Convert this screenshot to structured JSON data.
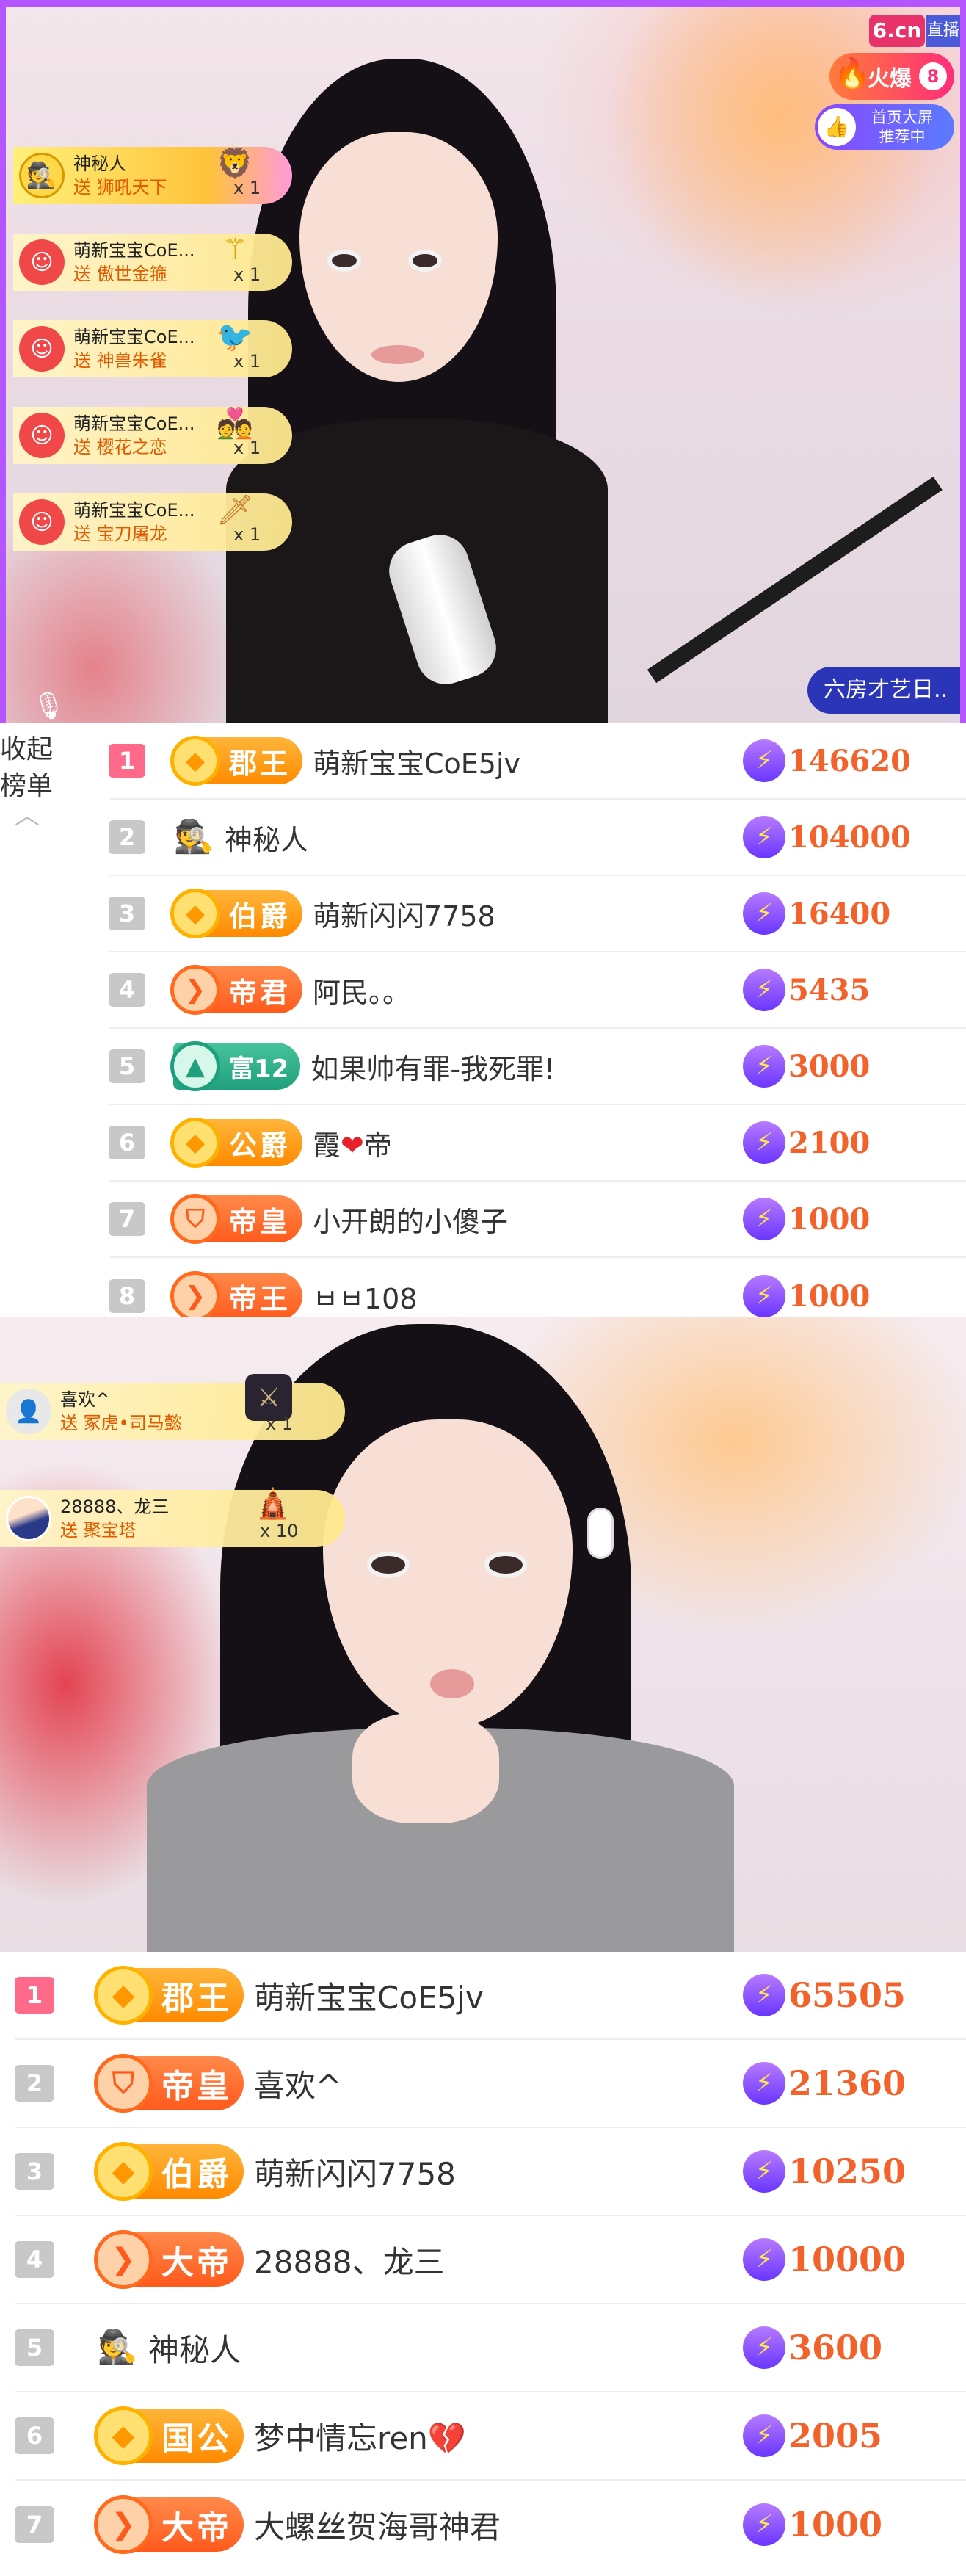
{
  "top_badges": {
    "logo": "6.cn",
    "live": "直播",
    "fire_label": "火爆",
    "fire_count": "8",
    "promo_line1": "首页大屏",
    "promo_line2": "推荐中"
  },
  "room_chip": "六房才艺日..",
  "collapse_label": "收起榜单",
  "gifts_top": [
    {
      "name": "神秘人",
      "action": "送 狮吼天下",
      "count": "x 1",
      "avatar": "mystery-icon",
      "gift_icon": "lion-statue-icon"
    },
    {
      "name": "萌新宝宝CoE...",
      "action": "送 傲世金箍",
      "count": "x 1",
      "avatar": "red-face-icon",
      "gift_icon": "golden-staff-icon"
    },
    {
      "name": "萌新宝宝CoE...",
      "action": "送 神兽朱雀",
      "count": "x 1",
      "avatar": "red-face-icon",
      "gift_icon": "phoenix-icon"
    },
    {
      "name": "萌新宝宝CoE...",
      "action": "送 樱花之恋",
      "count": "x 1",
      "avatar": "red-face-icon",
      "gift_icon": "couple-icon"
    },
    {
      "name": "萌新宝宝CoE...",
      "action": "送 宝刀屠龙",
      "count": "x 1",
      "avatar": "red-face-icon",
      "gift_icon": "sword-icon"
    }
  ],
  "gifts_bottom": [
    {
      "name": "喜欢^",
      "action": "送 冢虎•司马懿",
      "count": "x 1",
      "avatar": "default-user-icon",
      "gift_icon": "warrior-card-icon"
    },
    {
      "name": "28888、龙三",
      "action": "送 聚宝塔",
      "count": "x 10",
      "avatar": "user-photo",
      "gift_icon": "pagoda-icon"
    }
  ],
  "rank1": [
    {
      "rank": "1",
      "badge": "郡王",
      "badge_style": "gold",
      "name": "萌新宝宝CoE5jv",
      "score": "146620"
    },
    {
      "rank": "2",
      "badge": "",
      "badge_style": "mystery",
      "name": "神秘人",
      "score": "104000"
    },
    {
      "rank": "3",
      "badge": "伯爵",
      "badge_style": "gold",
      "name": "萌新闪闪7758",
      "score": "16400"
    },
    {
      "rank": "4",
      "badge": "帝君",
      "badge_style": "orange",
      "name": "阿民。。",
      "score": "5435"
    },
    {
      "rank": "5",
      "badge": "富12",
      "badge_style": "green",
      "name": "如果帅有罪-我死罪!",
      "score": "3000"
    },
    {
      "rank": "6",
      "badge": "公爵",
      "badge_style": "gold",
      "name": "霞",
      "name_suffix": "帝",
      "heart": true,
      "score": "2100"
    },
    {
      "rank": "7",
      "badge": "帝皇",
      "badge_style": "orange",
      "name": "小开朗的小傻子",
      "score": "1000"
    },
    {
      "rank": "8",
      "badge": "帝王",
      "badge_style": "orange",
      "name": "ㅂㅂ108",
      "score": "1000"
    }
  ],
  "rank2": [
    {
      "rank": "1",
      "badge": "郡王",
      "badge_style": "gold",
      "name": "萌新宝宝CoE5jv",
      "score": "65505"
    },
    {
      "rank": "2",
      "badge": "帝皇",
      "badge_style": "orange",
      "name": "喜欢^",
      "score": "21360"
    },
    {
      "rank": "3",
      "badge": "伯爵",
      "badge_style": "gold",
      "name": "萌新闪闪7758",
      "score": "10250"
    },
    {
      "rank": "4",
      "badge": "大帝",
      "badge_style": "orange",
      "name": "28888、龙三",
      "score": "10000"
    },
    {
      "rank": "5",
      "badge": "",
      "badge_style": "mystery",
      "name": "神秘人",
      "score": "3600"
    },
    {
      "rank": "6",
      "badge": "国公",
      "badge_style": "gold",
      "name": "梦中情忘ren",
      "heart": true,
      "score": "2005"
    },
    {
      "rank": "7",
      "badge": "大帝",
      "badge_style": "orange",
      "name": "大螺丝贺海哥神君",
      "score": "1000"
    }
  ],
  "colors": {
    "frame": "#b455ff",
    "score": "#f2622a",
    "rank_top": "#ff6a8a",
    "bolt": "#6a35ff"
  }
}
